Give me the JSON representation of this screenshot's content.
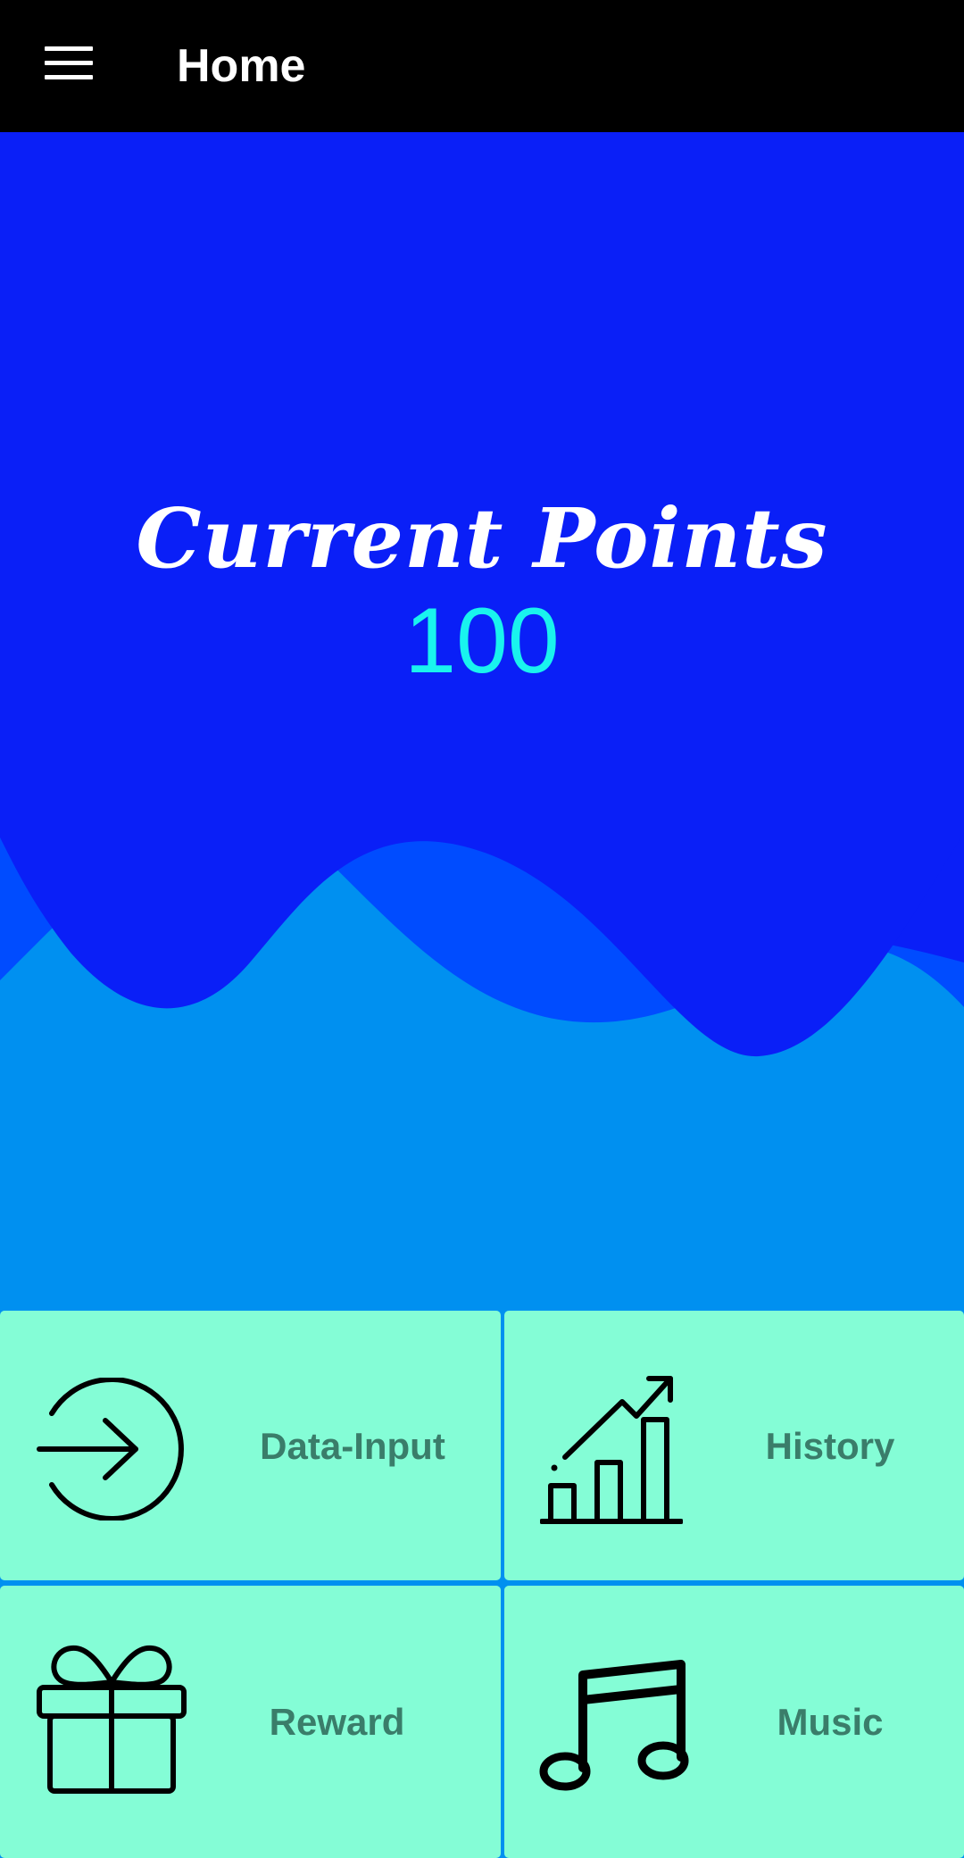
{
  "appbar": {
    "title": "Home",
    "menu_icon": "hamburger-menu-icon"
  },
  "hero": {
    "label": "Current Points",
    "points": "100",
    "colors": {
      "background": "#0a1ff7",
      "wave_back": "#004cff",
      "wave_front": "#0090f0",
      "points_value": "#19f3ee"
    }
  },
  "tiles": [
    {
      "label": "Data-Input",
      "icon": "login-arrow-icon"
    },
    {
      "label": "History",
      "icon": "growth-chart-icon"
    },
    {
      "label": "Reward",
      "icon": "gift-icon"
    },
    {
      "label": "Music",
      "icon": "music-note-icon"
    }
  ],
  "tile_colors": {
    "background": "#84fdd6",
    "label": "#3a7d6a"
  }
}
